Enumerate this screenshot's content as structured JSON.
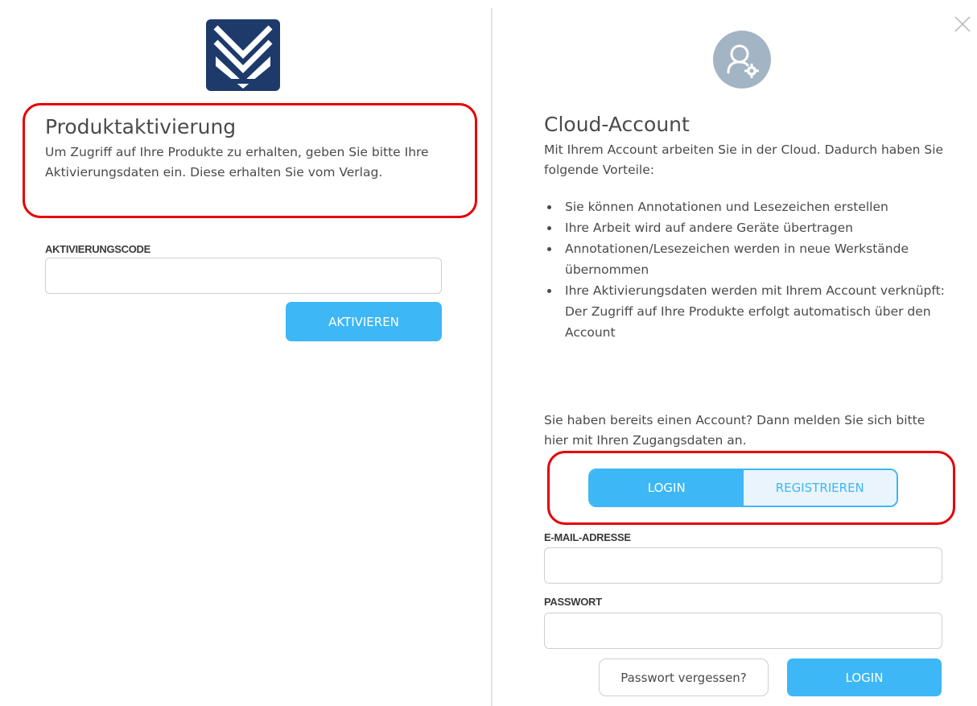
{
  "colors": {
    "accent": "#3db7f5",
    "highlight": "#e50000",
    "logo": "#1d3a6a",
    "avatar": "#a3b4c4"
  },
  "close_icon": "close-icon",
  "activation": {
    "title": "Produktaktivierung",
    "description": "Um Zugriff auf Ihre Produkte zu erhalten, geben Sie bitte Ihre Aktivierungsdaten ein. Diese erhalten Sie vom Verlag.",
    "code_label": "AKTIVIERUNGSCODE",
    "code_value": "",
    "activate_button": "AKTIVIEREN"
  },
  "account": {
    "title": "Cloud-Account",
    "description": "Mit Ihrem Account arbeiten Sie in der Cloud. Dadurch haben Sie folgende Vorteile:",
    "benefits": [
      "Sie können Annotationen und Lesezeichen erstellen",
      "Ihre Arbeit wird auf andere Geräte übertragen",
      "Annotationen/Lesezeichen werden in neue Werkstände übernommen",
      "Ihre Aktivierungsdaten werden mit Ihrem Account verknüpft:"
    ],
    "benefit_sub": "Der Zugriff auf Ihre Produkte erfolgt automatisch über den Account",
    "login_note": "Sie haben bereits einen Account? Dann melden Sie sich bitte hier mit Ihren Zugangsdaten an.",
    "tabs": {
      "login": "LOGIN",
      "register": "REGISTRIEREN",
      "selected": "LOGIN"
    },
    "email_label": "E-MAIL-ADRESSE",
    "email_value": "",
    "password_label": "PASSWORT",
    "password_value": "",
    "forgot_button": "Passwort vergessen?",
    "login_button": "LOGIN"
  }
}
